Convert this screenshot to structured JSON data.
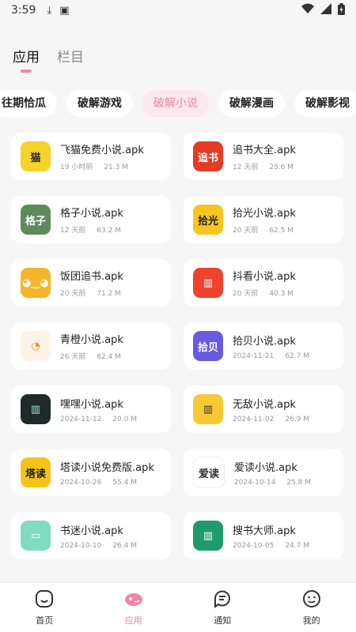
{
  "status": {
    "time": "3:59"
  },
  "tabs": [
    {
      "label": "应用",
      "active": true
    },
    {
      "label": "栏目",
      "active": false
    }
  ],
  "chips": [
    {
      "label": "往期恰瓜",
      "active": false
    },
    {
      "label": "破解游戏",
      "active": false
    },
    {
      "label": "破解小说",
      "active": true
    },
    {
      "label": "破解漫画",
      "active": false
    },
    {
      "label": "破解影视",
      "active": false
    }
  ],
  "apps": [
    {
      "name": "飞猫免费小说.apk",
      "time": "19 小时前",
      "size": "21.3 M",
      "icon": "cat-icon",
      "icon_bg": "#f7d22b",
      "icon_text": "猫",
      "icon_color": "#222"
    },
    {
      "name": "追书大全.apk",
      "time": "12 天前",
      "size": "25.6 M",
      "icon": "zhuishu-icon",
      "icon_bg": "#e33b25",
      "icon_text": "追书",
      "icon_color": "#fff"
    },
    {
      "name": "格子小说.apk",
      "time": "12 天前",
      "size": "63.2 M",
      "icon": "grid-book-icon",
      "icon_bg": "#5f8a5c",
      "icon_text": "格子",
      "icon_color": "#fff"
    },
    {
      "name": "拾光小说.apk",
      "time": "20 天前",
      "size": "62.5 M",
      "icon": "shiguang-icon",
      "icon_bg": "#f7c51c",
      "icon_text": "拾光",
      "icon_color": "#222"
    },
    {
      "name": "饭团追书.apk",
      "time": "20 天前",
      "size": "71.2 M",
      "icon": "ricebal-icon",
      "icon_bg": "#f6b52b",
      "icon_text": "◕‿◕",
      "icon_color": "#fff"
    },
    {
      "name": "抖看小说.apk",
      "time": "20 天前",
      "size": "40.3 M",
      "icon": "open-book-icon",
      "icon_bg": "#f0432c",
      "icon_text": "▥",
      "icon_color": "#fff"
    },
    {
      "name": "青橙小说.apk",
      "time": "26 天前",
      "size": "62.4 M",
      "icon": "orange-icon",
      "icon_bg": "#fff3e8",
      "icon_text": "◔",
      "icon_color": "#f28a1a"
    },
    {
      "name": "拾贝小说.apk",
      "time": "2024-11-21",
      "size": "62.7 M",
      "icon": "shibei-icon",
      "icon_bg": "#6a5ae0",
      "icon_text": "拾贝",
      "icon_color": "#fff"
    },
    {
      "name": "嘿嘿小说.apk",
      "time": "2024-11-12",
      "size": "20.0 M",
      "icon": "dark-book-icon",
      "icon_bg": "#1f2a2a",
      "icon_text": "▥",
      "icon_color": "#9fe0d0"
    },
    {
      "name": "无敌小说.apk",
      "time": "2024-11-02",
      "size": "26.9 M",
      "icon": "yellow-book-icon",
      "icon_bg": "#f7c933",
      "icon_text": "▥",
      "icon_color": "#333"
    },
    {
      "name": "塔读小说免费版.apk",
      "time": "2024-10-26",
      "size": "55.4 M",
      "icon": "tadu-icon",
      "icon_bg": "#f6c419",
      "icon_text": "塔读",
      "icon_color": "#222"
    },
    {
      "name": "爱读小说.apk",
      "time": "2024-10-14",
      "size": "25.8 M",
      "icon": "aidu-icon",
      "icon_bg": "#ffffff",
      "icon_text": "爱读",
      "icon_color": "#333"
    },
    {
      "name": "书迷小说.apk",
      "time": "2024-10-10",
      "size": "26.4 M",
      "icon": "green-book-icon",
      "icon_bg": "#7fdcc0",
      "icon_text": "▭",
      "icon_color": "#fff"
    },
    {
      "name": "搜书大师.apk",
      "time": "2024-10-05",
      "size": "24.7 M",
      "icon": "search-book-icon",
      "icon_bg": "#1e9a6e",
      "icon_text": "▥",
      "icon_color": "#fff"
    }
  ],
  "bottom_nav": [
    {
      "label": "首页",
      "icon": "home-icon",
      "active": false
    },
    {
      "label": "应用",
      "icon": "apps-icon",
      "active": true
    },
    {
      "label": "通知",
      "icon": "notification-icon",
      "active": false
    },
    {
      "label": "我的",
      "icon": "profile-icon",
      "active": false
    }
  ],
  "colors": {
    "accent": "#ee86a0",
    "background": "#f6f6f7"
  }
}
